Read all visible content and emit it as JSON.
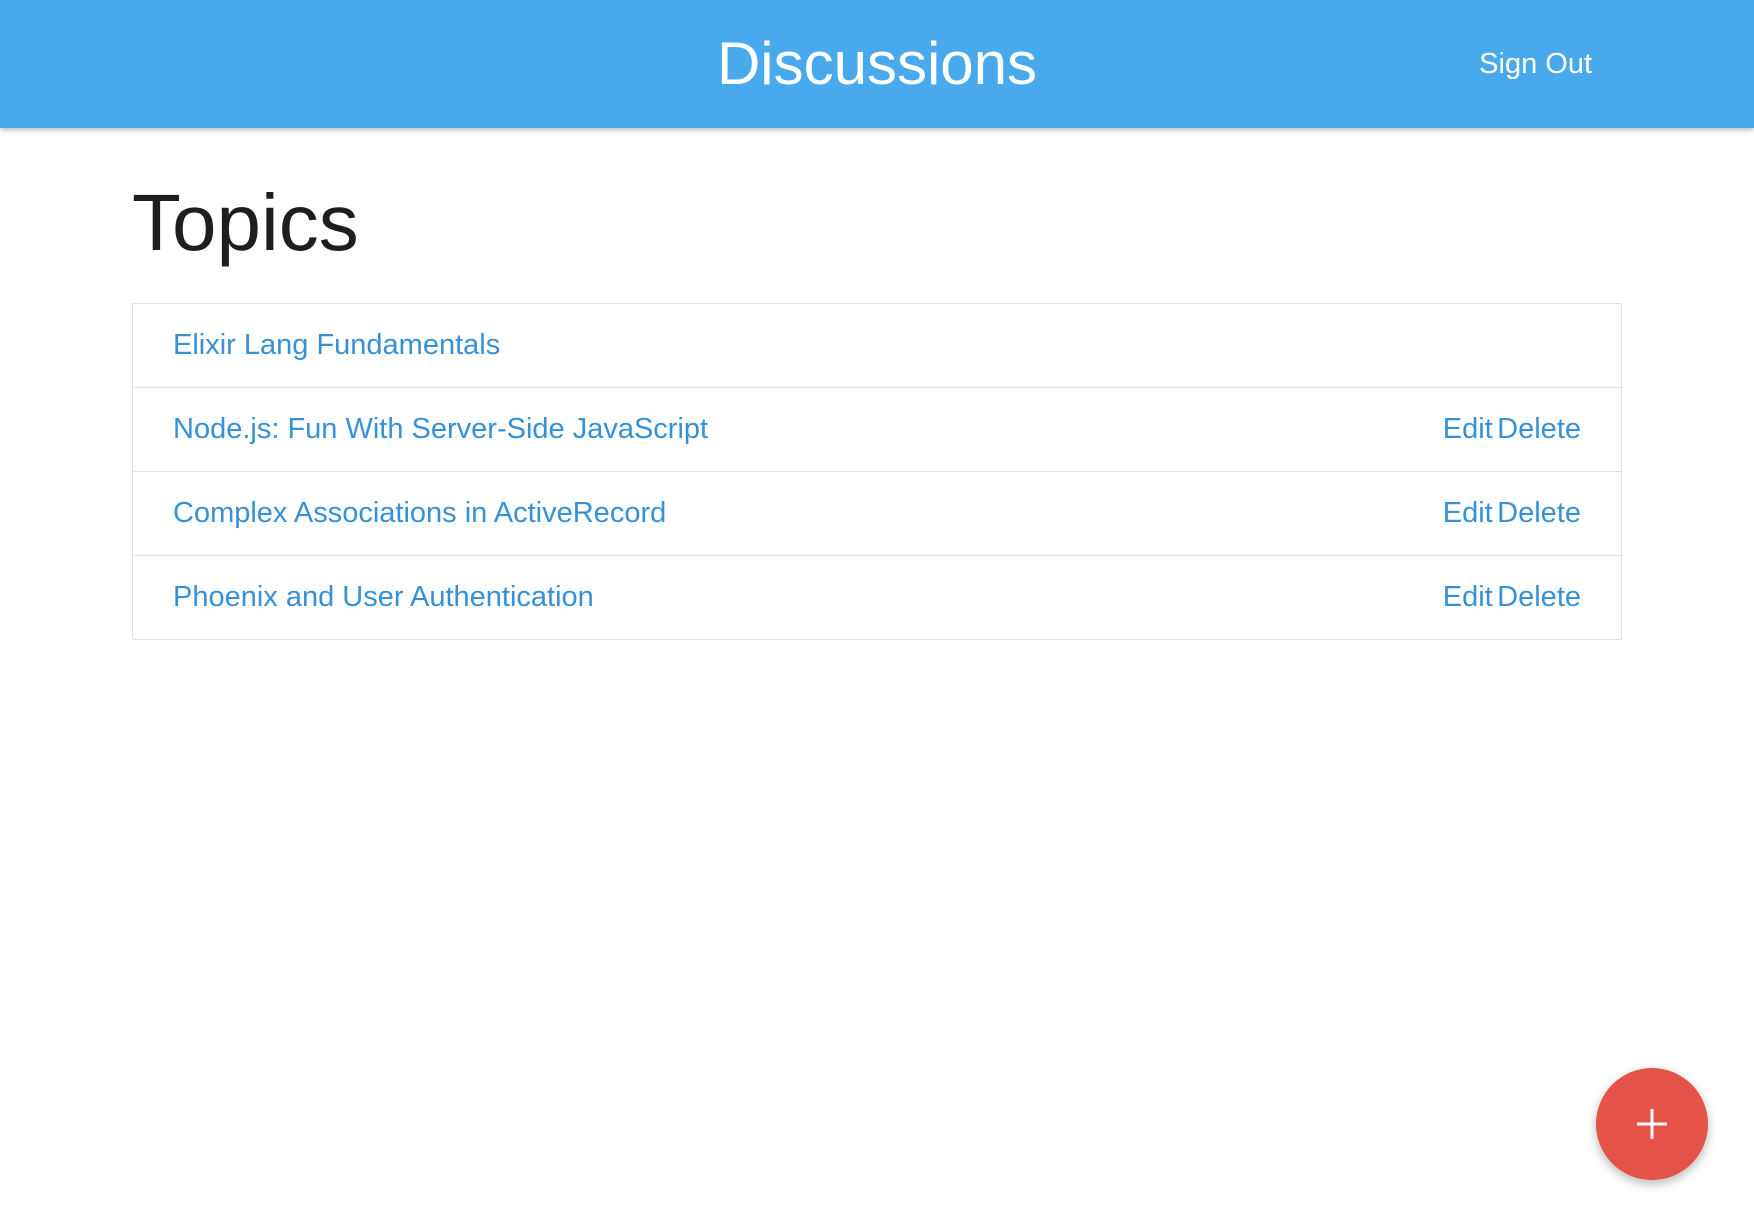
{
  "navbar": {
    "brand": "Discussions",
    "sign_out_label": "Sign Out",
    "background_color": "#48a9ec"
  },
  "main": {
    "title": "Topics",
    "topics": [
      {
        "title": "Elixir Lang Fundamentals",
        "actions": []
      },
      {
        "title": "Node.js: Fun With Server-Side JavaScript",
        "actions": [
          "Edit",
          "Delete"
        ]
      },
      {
        "title": "Complex Associations in ActiveRecord",
        "actions": [
          "Edit",
          "Delete"
        ]
      },
      {
        "title": "Phoenix and User Authentication",
        "actions": [
          "Edit",
          "Delete"
        ]
      }
    ],
    "link_color": "#3791d6"
  },
  "fab": {
    "icon": "plus-icon",
    "color": "#e55247"
  }
}
